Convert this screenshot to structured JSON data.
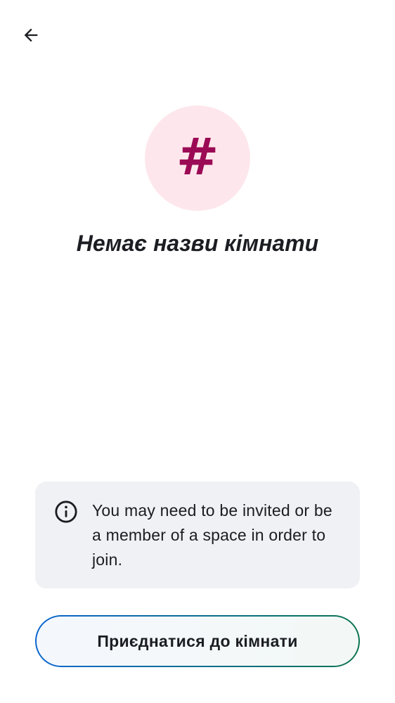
{
  "header": {
    "back_icon": "arrow-left-icon"
  },
  "room": {
    "avatar_glyph": "#",
    "avatar_icon": "hash-icon",
    "title": "Немає назви кімнати"
  },
  "notice": {
    "icon": "info-icon",
    "text": "You may need to be invited or be a member of a space in order to join."
  },
  "actions": {
    "join_label": "Приєднатися до кімнати"
  },
  "colors": {
    "avatar_background": "#fde7ec",
    "avatar_glyph": "#9b0a55",
    "notice_background": "#f0f1f4",
    "button_border_start": "#0b67d0",
    "button_border_end": "#0d7452",
    "text": "#1b1d22"
  }
}
